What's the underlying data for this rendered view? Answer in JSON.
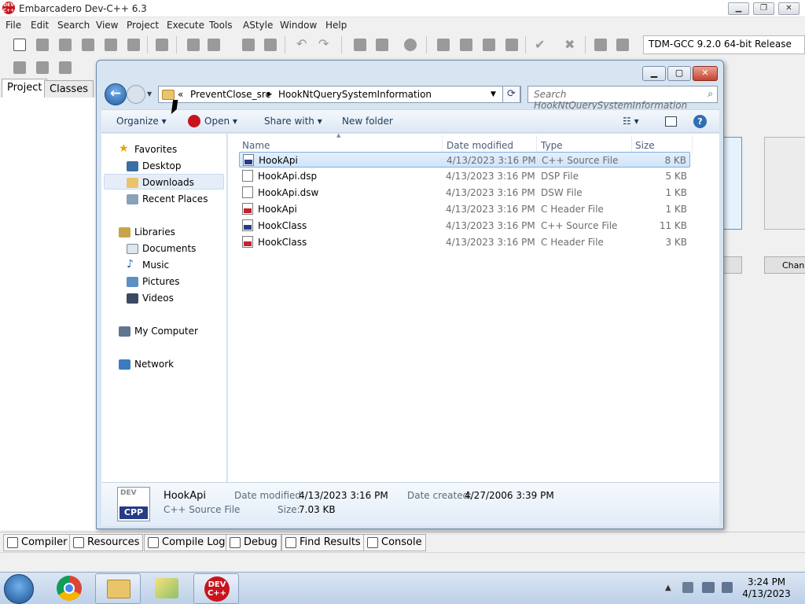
{
  "app": {
    "title": "Embarcadero Dev-C++ 6.3",
    "logo_text": "DEV C++",
    "menu": [
      "File",
      "Edit",
      "Search",
      "View",
      "Project",
      "Execute",
      "Tools",
      "AStyle",
      "Window",
      "Help"
    ],
    "compiler": "TDM-GCC 9.2.0 64-bit Release",
    "left_tabs": [
      "Project",
      "Classes"
    ],
    "bottom_tabs": [
      "Compiler",
      "Resources",
      "Compile Log",
      "Debug",
      "Find Results",
      "Console"
    ],
    "right_partial_button": "Chang",
    "window_buttons": {
      "min": "▁",
      "max": "❐",
      "close": "✕"
    }
  },
  "dialog": {
    "window_buttons": {
      "min": "▁",
      "max": "▢",
      "close": "✕"
    },
    "breadcrumb": {
      "prefix": "«",
      "segments": [
        "PreventClose_src",
        "HookNtQuerySystemInformation"
      ]
    },
    "search_placeholder": "Search HookNtQuerySystemInformation",
    "commands": {
      "organize": "Organize",
      "open": "Open",
      "share_with": "Share with",
      "new_folder": "New folder"
    },
    "nav": {
      "favorites": {
        "label": "Favorites",
        "items": [
          "Desktop",
          "Downloads",
          "Recent Places"
        ]
      },
      "libraries": {
        "label": "Libraries",
        "items": [
          "Documents",
          "Music",
          "Pictures",
          "Videos"
        ]
      },
      "computer": "My Computer",
      "network": "Network"
    },
    "columns": {
      "name": "Name",
      "date": "Date modified",
      "type": "Type",
      "size": "Size"
    },
    "files": [
      {
        "name": "HookApi",
        "date": "4/13/2023 3:16 PM",
        "type": "C++ Source File",
        "size": "8 KB",
        "icon": "cpp"
      },
      {
        "name": "HookApi.dsp",
        "date": "4/13/2023 3:16 PM",
        "type": "DSP File",
        "size": "5 KB",
        "icon": "blank"
      },
      {
        "name": "HookApi.dsw",
        "date": "4/13/2023 3:16 PM",
        "type": "DSW File",
        "size": "1 KB",
        "icon": "blank"
      },
      {
        "name": "HookApi",
        "date": "4/13/2023 3:16 PM",
        "type": "C Header File",
        "size": "1 KB",
        "icon": "h"
      },
      {
        "name": "HookClass",
        "date": "4/13/2023 3:16 PM",
        "type": "C++ Source File",
        "size": "11 KB",
        "icon": "cpp"
      },
      {
        "name": "HookClass",
        "date": "4/13/2023 3:16 PM",
        "type": "C Header File",
        "size": "3 KB",
        "icon": "h"
      }
    ],
    "details": {
      "name": "HookApi",
      "type": "C++ Source File",
      "date_modified_label": "Date modified:",
      "date_modified": "4/13/2023 3:16 PM",
      "date_created_label": "Date created:",
      "date_created": "4/27/2006 3:39 PM",
      "size_label": "Size:",
      "size": "7.03 KB",
      "icon_text_top": "DEV",
      "icon_text": "CPP"
    }
  },
  "taskbar": {
    "time": "3:24 PM",
    "date": "4/13/2023",
    "devcpp_label": "DEV C++"
  }
}
